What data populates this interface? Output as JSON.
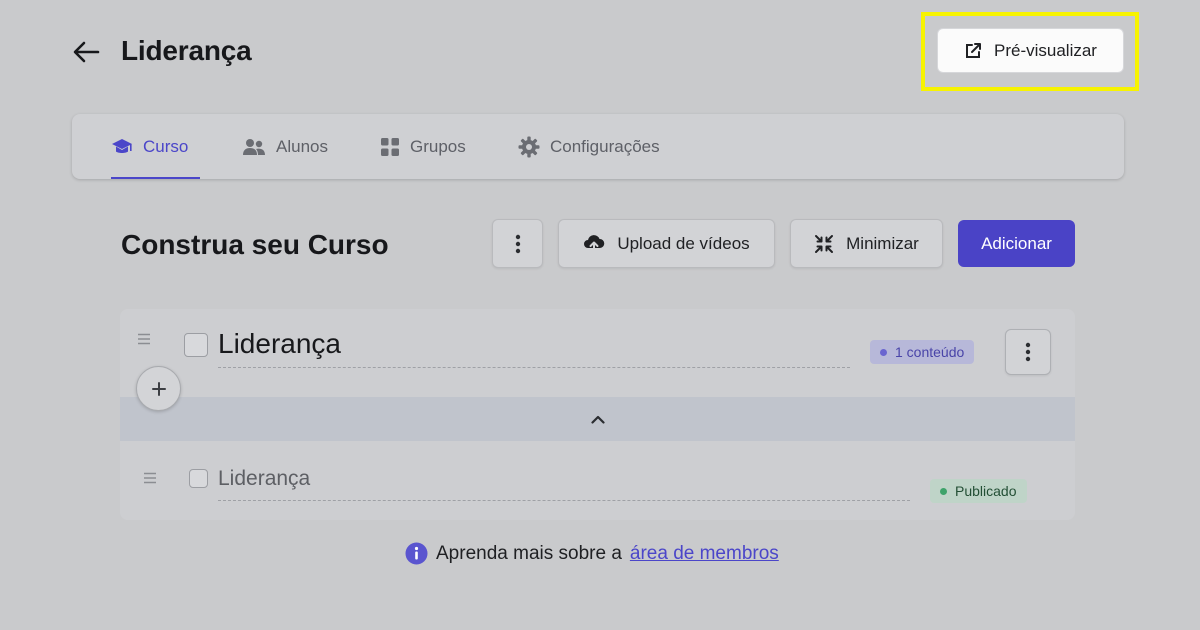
{
  "header": {
    "title": "Liderança",
    "preview_label": "Pré-visualizar"
  },
  "tabs": [
    {
      "label": "Curso",
      "icon": "graduation-cap-icon",
      "active": true
    },
    {
      "label": "Alunos",
      "icon": "users-icon",
      "active": false
    },
    {
      "label": "Grupos",
      "icon": "grid-icon",
      "active": false
    },
    {
      "label": "Configurações",
      "icon": "gear-icon",
      "active": false
    }
  ],
  "builder": {
    "title": "Construa seu Curso",
    "upload_label": "Upload de vídeos",
    "minimize_label": "Minimizar",
    "add_label": "Adicionar"
  },
  "module": {
    "title": "Liderança",
    "count_badge": "1 conteúdo",
    "lesson": {
      "title": "Liderança",
      "status": "Publicado"
    }
  },
  "info": {
    "text": "Aprenda mais sobre a",
    "link": "área de membros"
  },
  "colors": {
    "accent": "#4a43c6",
    "highlight": "#f7f300",
    "published": "#3ea36a"
  }
}
